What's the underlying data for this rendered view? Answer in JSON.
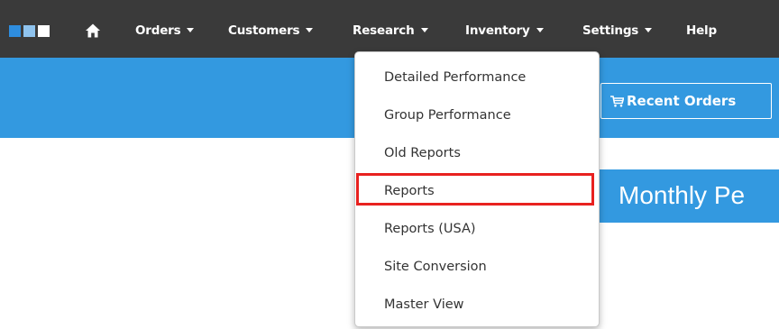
{
  "navbar": {
    "menu": [
      {
        "label": "Orders",
        "has_caret": true
      },
      {
        "label": "Customers",
        "has_caret": true
      },
      {
        "label": "Research",
        "has_caret": true
      },
      {
        "label": "Inventory",
        "has_caret": true
      },
      {
        "label": "Settings",
        "has_caret": true
      },
      {
        "label": "Help",
        "has_caret": false
      }
    ],
    "icons": [
      "app-logo",
      "home-icon",
      "chevron-down-icon"
    ]
  },
  "header": {
    "recent_orders_label": "Recent Orders",
    "recent_orders_icon": "cart-icon"
  },
  "main": {
    "title": "Monthly Pe"
  },
  "research_dropdown": {
    "items": [
      {
        "label": "Detailed Performance"
      },
      {
        "label": "Group Performance"
      },
      {
        "label": "Old Reports"
      },
      {
        "label": "Reports",
        "highlighted": true
      },
      {
        "label": "Reports (USA)"
      },
      {
        "label": "Site Conversion"
      },
      {
        "label": "Master View"
      }
    ]
  },
  "colors": {
    "navbar_bg": "#3a3a3a",
    "accent_blue": "#3399e0",
    "highlight_red": "#e8211f",
    "menu_text": "#333333"
  }
}
